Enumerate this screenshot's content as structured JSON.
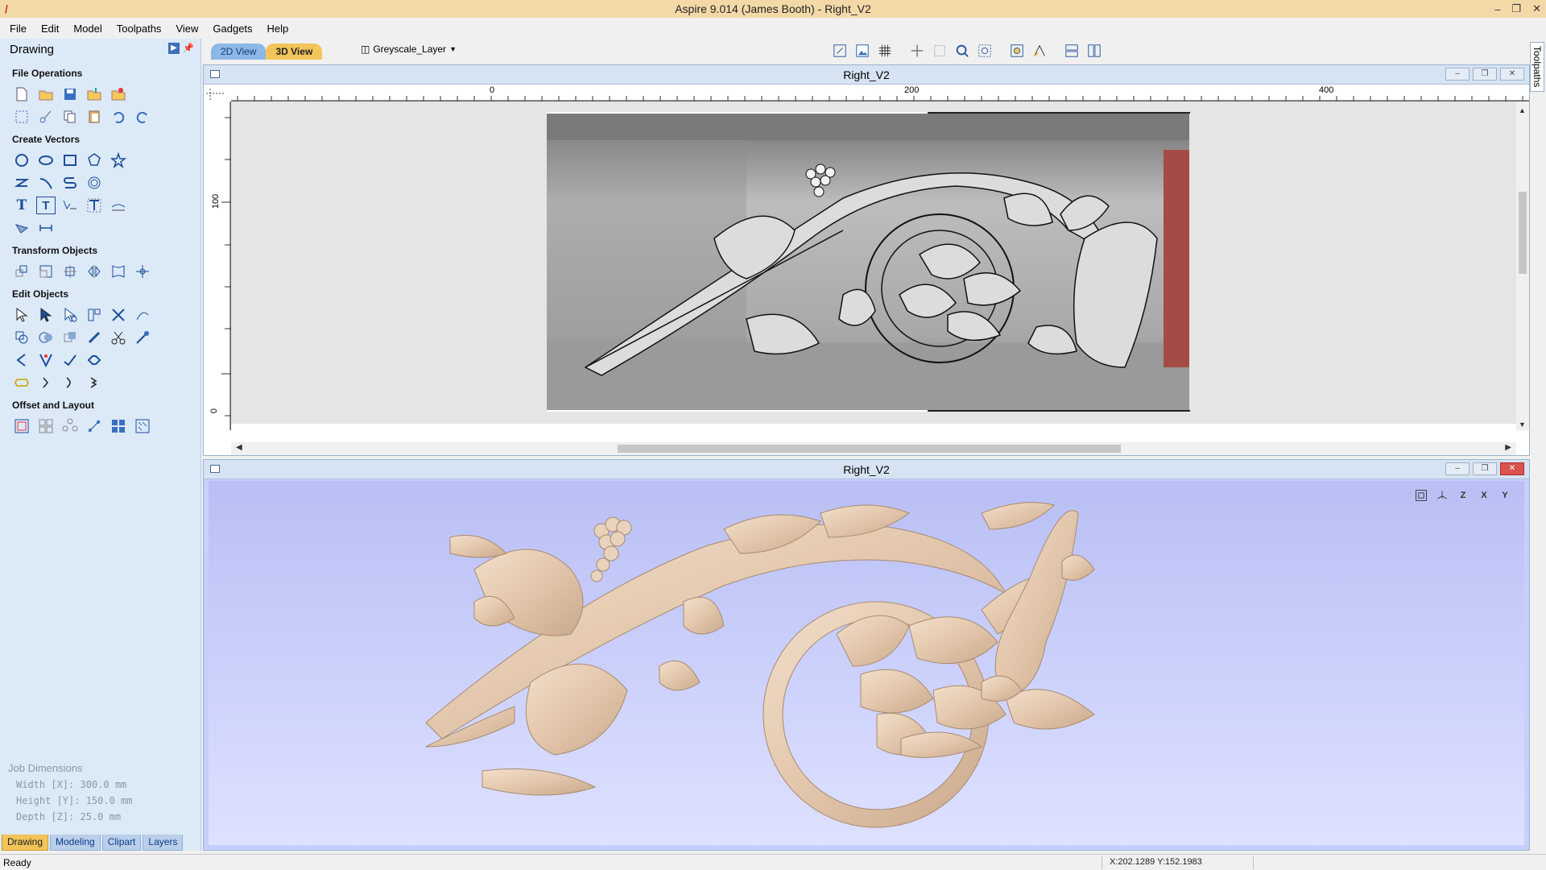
{
  "window": {
    "title": "Aspire 9.014 (James Booth) - Right_V2"
  },
  "menu": [
    "File",
    "Edit",
    "Model",
    "Toolpaths",
    "View",
    "Gadgets",
    "Help"
  ],
  "left_panel": {
    "title": "Drawing",
    "sections": {
      "file_ops": "File Operations",
      "create_vectors": "Create Vectors",
      "transform": "Transform Objects",
      "edit": "Edit Objects",
      "offset": "Offset and Layout"
    },
    "job_dimensions": {
      "title": "Job Dimensions",
      "width": "Width  [X]: 300.0 mm",
      "height": "Height [Y]: 150.0 mm",
      "depth": "Depth  [Z]: 25.0 mm"
    },
    "tabs": [
      "Drawing",
      "Modeling",
      "Clipart",
      "Layers"
    ]
  },
  "view_tabs": {
    "t2d": "2D View",
    "t3d": "3D View"
  },
  "layer": {
    "name": "Greyscale_Layer"
  },
  "view2d": {
    "title": "Right_V2",
    "ruler_h_labels": [
      "0",
      "200",
      "400"
    ],
    "ruler_v_labels": [
      "100",
      "0"
    ]
  },
  "view3d": {
    "title": "Right_V2",
    "tool_labels": [
      "Z",
      "X",
      "Y"
    ]
  },
  "side_tab": "Toolpaths",
  "status": {
    "text": "Ready",
    "coords": "X:202.1289 Y:152.1983"
  },
  "colors": {
    "titlebar": "#f4d9a8",
    "panel_bg": "#dce9f7",
    "active_tab": "#f3c45a",
    "relief": "#e8cdb5",
    "view3d_bg": "#c7cfff"
  }
}
